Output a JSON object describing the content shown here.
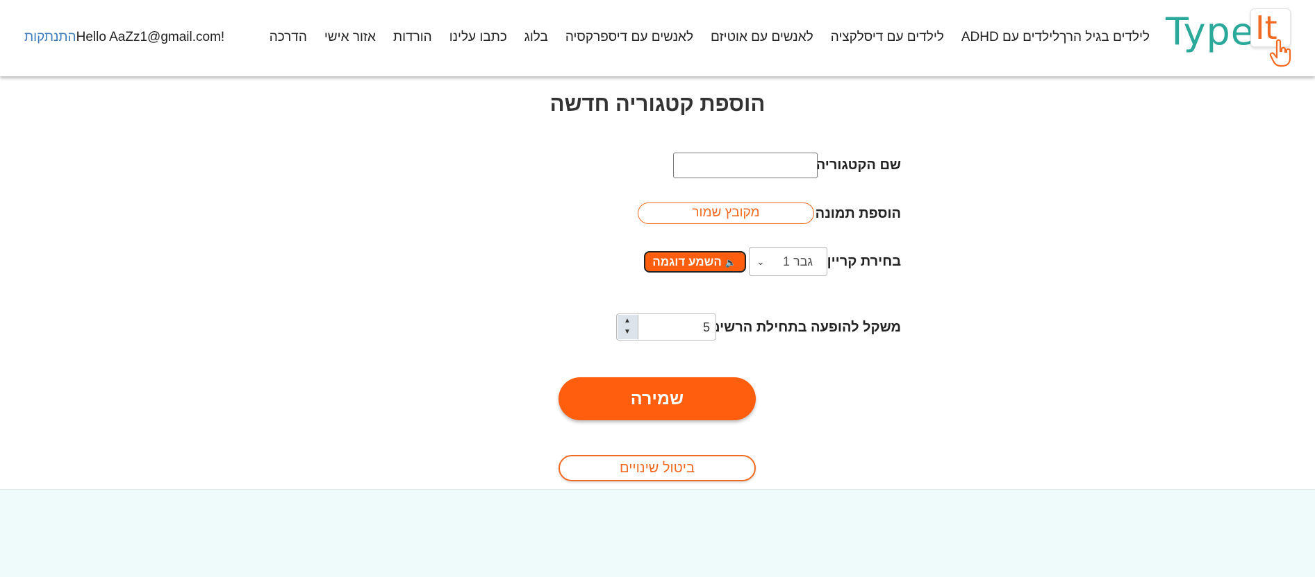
{
  "header": {
    "logo": {
      "type_text": "Type",
      "it_text": "It"
    },
    "nav": [
      {
        "label": "לילדים בגיל הרך"
      },
      {
        "label": "לילדים עם ADHD"
      },
      {
        "label": "לילדים עם דיסלקציה"
      },
      {
        "label": "לאנשים עם אוטיזם"
      },
      {
        "label": "לאנשים עם דיספרקסיה"
      },
      {
        "label": "בלוג"
      },
      {
        "label": "כתבו עלינו"
      },
      {
        "label": "הורדות"
      },
      {
        "label": "אזור אישי"
      },
      {
        "label": "הדרכה"
      }
    ],
    "greeting": "Hello AaZz1@gmail.com!",
    "logout_label": "התנתקות"
  },
  "form": {
    "title": "הוספת קטגוריה חדשה",
    "category_name_label": "שם הקטגוריה",
    "category_name_value": "",
    "image_label": "הוספת תמונה",
    "image_button_label": "מקובץ שמור",
    "voice_label": "בחירת קריין",
    "voice_selected": "גבר 1",
    "sample_button_label": "השמע דוגמה",
    "weight_label": "משקל להופעה בתחילת הרשימה",
    "weight_value": "5",
    "save_label": "שמירה",
    "cancel_label": "ביטול שינויים"
  },
  "colors": {
    "accent": "#ff5e0e",
    "brand_teal": "#2aa89a",
    "link": "#3b7bbf",
    "footer_bg": "#effafa"
  },
  "icons": [
    "hand-pointer-icon",
    "speaker-icon",
    "chevron-down-icon",
    "spinner-up-icon",
    "spinner-down-icon"
  ]
}
